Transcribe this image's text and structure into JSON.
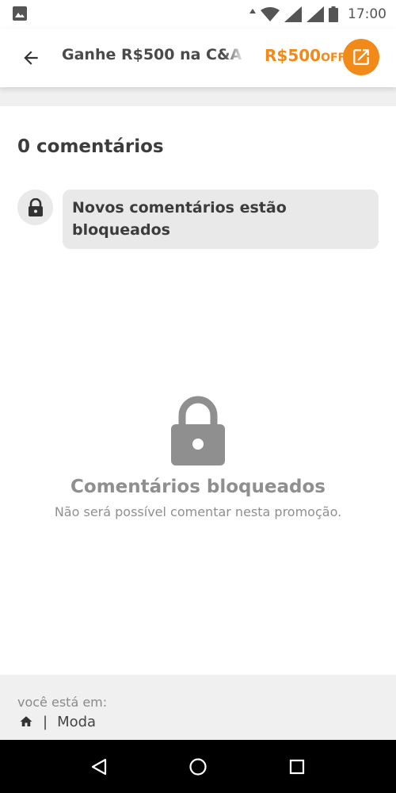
{
  "status_bar": {
    "time": "17:00",
    "icons": [
      "image-icon",
      "data-arrows-icon",
      "wifi-icon",
      "signal-icon",
      "signal-icon",
      "battery-icon"
    ]
  },
  "header": {
    "title": "Ganhe R$500 na C&A",
    "title_overflow": " c",
    "discount_amount": "R$500",
    "discount_suffix": "OFF",
    "back_icon": "arrow-back-icon",
    "open_icon": "open-external-icon",
    "accent_color": "#f28a1a"
  },
  "comments": {
    "count_label": "0 comentários",
    "locked_notice": "Novos comentários estão bloqueados",
    "lock_icon": "lock-icon"
  },
  "empty_state": {
    "title": "Comentários bloqueados",
    "subtitle": "Não será possível comentar nesta promoção."
  },
  "footer": {
    "label": "você está em:",
    "home_icon": "home-icon",
    "separator": "|",
    "category": "Moda"
  },
  "nav_bar": {
    "buttons": [
      "back-triangle-icon",
      "home-circle-icon",
      "recents-square-icon"
    ]
  }
}
